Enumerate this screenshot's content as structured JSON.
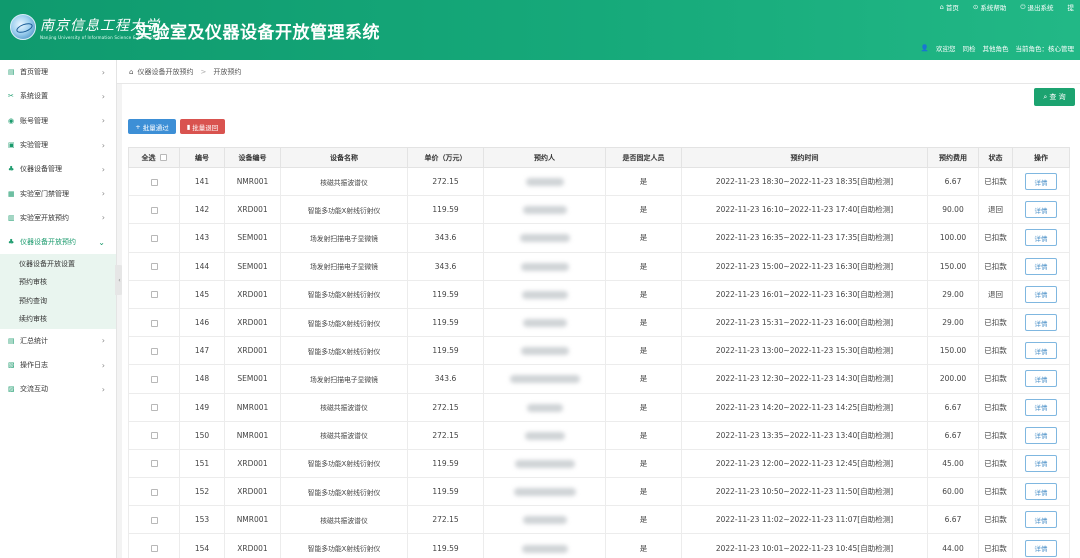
{
  "header": {
    "school_name": "南京信息工程大学",
    "school_en": "Nanjing University of Information Science & Technology",
    "system_title": "实验室及仪器设备开放管理系统",
    "links": [
      {
        "icon": "home-icon",
        "label": "首页"
      },
      {
        "icon": "help-icon",
        "label": "系统帮助"
      },
      {
        "icon": "power-icon",
        "label": "退出系统"
      },
      {
        "icon": "",
        "label": "提"
      }
    ],
    "user": {
      "welcome": "欢迎您",
      "name": "同检",
      "other_role": "其他角色",
      "current_role": "当前角色：核心管理"
    }
  },
  "sidebar": {
    "items": [
      {
        "icon": "home-icon",
        "label": "首页管理"
      },
      {
        "icon": "settings-icon",
        "label": "系统设置"
      },
      {
        "icon": "user-icon",
        "label": "账号管理"
      },
      {
        "icon": "document-icon",
        "label": "实验管理"
      },
      {
        "icon": "instrument-icon",
        "label": "仪器设备管理"
      },
      {
        "icon": "door-icon",
        "label": "实验室门禁管理"
      },
      {
        "icon": "calendar-icon",
        "label": "实验室开放预约"
      },
      {
        "icon": "instrument-icon",
        "label": "仪器设备开放预约"
      }
    ],
    "subitems": [
      {
        "label": "仪器设备开放设置"
      },
      {
        "label": "预约审核"
      },
      {
        "label": "预约查询"
      },
      {
        "label": "续约审核"
      }
    ],
    "bottom_items": [
      {
        "icon": "chart-icon",
        "label": "汇总统计"
      },
      {
        "icon": "log-icon",
        "label": "操作日志"
      },
      {
        "icon": "chat-icon",
        "label": "交流互动"
      }
    ]
  },
  "breadcrumb": {
    "parent": "仪器设备开放预约",
    "current": "开放预约"
  },
  "toolbar": {
    "query_label": "查 询",
    "batch_pass_label": "批量通过",
    "batch_return_label": "批量退回"
  },
  "table": {
    "headers": {
      "select_all": "全选",
      "no": "编号",
      "device_code": "设备编号",
      "device_name": "设备名称",
      "price": "单价（万元）",
      "booker": "预约人",
      "fixed": "是否固定人员",
      "time": "预约时间",
      "fee": "预约费用",
      "status": "状态",
      "action": "操作"
    },
    "rows": [
      {
        "no": "141",
        "code": "NMR001",
        "name": "核磁共振波谱仪",
        "price": "272.15",
        "fixed": "是",
        "time": "2022-11-23 18:30~2022-11-23 18:35[自助检测]",
        "fee": "6.67",
        "status": "已扣款",
        "action": "详情"
      },
      {
        "no": "142",
        "code": "XRD001",
        "name": "智能多功能X射线衍射仪",
        "price": "119.59",
        "fixed": "是",
        "time": "2022-11-23 16:10~2022-11-23 17:40[自助检测]",
        "fee": "90.00",
        "status": "退回",
        "action": "详情"
      },
      {
        "no": "143",
        "code": "SEM001",
        "name": "场发射扫描电子显微镜",
        "price": "343.6",
        "fixed": "是",
        "time": "2022-11-23 16:35~2022-11-23 17:35[自助检测]",
        "fee": "100.00",
        "status": "已扣款",
        "action": "详情"
      },
      {
        "no": "144",
        "code": "SEM001",
        "name": "场发射扫描电子显微镜",
        "price": "343.6",
        "fixed": "是",
        "time": "2022-11-23 15:00~2022-11-23 16:30[自助检测]",
        "fee": "150.00",
        "status": "已扣款",
        "action": "详情"
      },
      {
        "no": "145",
        "code": "XRD001",
        "name": "智能多功能X射线衍射仪",
        "price": "119.59",
        "fixed": "是",
        "time": "2022-11-23 16:01~2022-11-23 16:30[自助检测]",
        "fee": "29.00",
        "status": "退回",
        "action": "详情"
      },
      {
        "no": "146",
        "code": "XRD001",
        "name": "智能多功能X射线衍射仪",
        "price": "119.59",
        "fixed": "是",
        "time": "2022-11-23 15:31~2022-11-23 16:00[自助检测]",
        "fee": "29.00",
        "status": "已扣款",
        "action": "详情"
      },
      {
        "no": "147",
        "code": "XRD001",
        "name": "智能多功能X射线衍射仪",
        "price": "119.59",
        "fixed": "是",
        "time": "2022-11-23 13:00~2022-11-23 15:30[自助检测]",
        "fee": "150.00",
        "status": "已扣款",
        "action": "详情"
      },
      {
        "no": "148",
        "code": "SEM001",
        "name": "场发射扫描电子显微镜",
        "price": "343.6",
        "fixed": "是",
        "time": "2022-11-23 12:30~2022-11-23 14:30[自助检测]",
        "fee": "200.00",
        "status": "已扣款",
        "action": "详情"
      },
      {
        "no": "149",
        "code": "NMR001",
        "name": "核磁共振波谱仪",
        "price": "272.15",
        "fixed": "是",
        "time": "2022-11-23 14:20~2022-11-23 14:25[自助检测]",
        "fee": "6.67",
        "status": "已扣款",
        "action": "详情"
      },
      {
        "no": "150",
        "code": "NMR001",
        "name": "核磁共振波谱仪",
        "price": "272.15",
        "fixed": "是",
        "time": "2022-11-23 13:35~2022-11-23 13:40[自助检测]",
        "fee": "6.67",
        "status": "已扣款",
        "action": "详情"
      },
      {
        "no": "151",
        "code": "XRD001",
        "name": "智能多功能X射线衍射仪",
        "price": "119.59",
        "fixed": "是",
        "time": "2022-11-23 12:00~2022-11-23 12:45[自助检测]",
        "fee": "45.00",
        "status": "已扣款",
        "action": "详情"
      },
      {
        "no": "152",
        "code": "XRD001",
        "name": "智能多功能X射线衍射仪",
        "price": "119.59",
        "fixed": "是",
        "time": "2022-11-23 10:50~2022-11-23 11:50[自助检测]",
        "fee": "60.00",
        "status": "已扣款",
        "action": "详情"
      },
      {
        "no": "153",
        "code": "NMR001",
        "name": "核磁共振波谱仪",
        "price": "272.15",
        "fixed": "是",
        "time": "2022-11-23 11:02~2022-11-23 11:07[自助检测]",
        "fee": "6.67",
        "status": "已扣款",
        "action": "详情"
      },
      {
        "no": "154",
        "code": "XRD001",
        "name": "智能多功能X射线衍射仪",
        "price": "119.59",
        "fixed": "是",
        "time": "2022-11-23 10:01~2022-11-23 10:45[自助检测]",
        "fee": "44.00",
        "status": "已扣款",
        "action": "详情"
      }
    ]
  },
  "colors": {
    "brand_green": "#16a97a",
    "query_button": "#1ca370",
    "batch_pass": "#3d8fd6",
    "batch_return": "#d9534f",
    "detail_border": "#7fb7e0"
  }
}
